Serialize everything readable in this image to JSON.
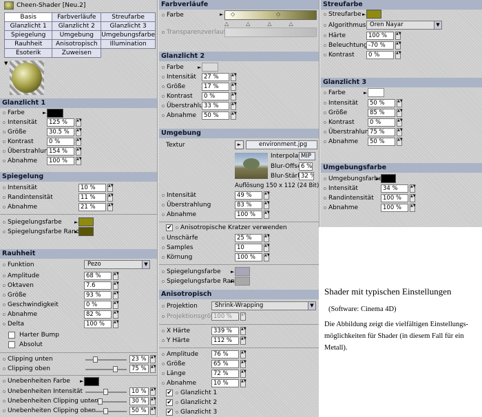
{
  "window": {
    "title": "Cheen-Shader [Neu.2]"
  },
  "tabs": [
    "Basis",
    "Farbverläufe",
    "Streufarbe",
    "Glanzlicht 1",
    "Glanzlicht 2",
    "Glanzlicht 3",
    "Spiegelung",
    "Umgebung",
    "Umgebungsfarbe",
    "Rauhheit",
    "Anisotropisch",
    "Illumination",
    "Esoterik",
    "Zuweisen"
  ],
  "glanz1": {
    "title": "Glanzlicht 1",
    "farbe": "Farbe",
    "intensitat": "Intensität",
    "intensitat_val": "125 %",
    "grosse": "Größe",
    "grosse_val": "30.5 %",
    "kontrast": "Kontrast",
    "kontrast_val": "0 %",
    "uber": "Überstrahlung",
    "uber_val": "154 %",
    "abnahme": "Abnahme",
    "abnahme_val": "100 %"
  },
  "spiegel": {
    "title": "Spiegelung",
    "intensitat": "Intensität",
    "intensitat_val": "10 %",
    "rand": "Randintensität",
    "rand_val": "11 %",
    "abnahme": "Abnahme",
    "abnahme_val": "21 %",
    "farbe": "Spiegelungsfarbe",
    "farbe_rand": "Spiegelungsfarbe Rand"
  },
  "rauh": {
    "title": "Rauhheit",
    "funktion": "Funktion",
    "funktion_val": "Pezo",
    "amplitude": "Amplitude",
    "amplitude_val": "68 %",
    "oktaven": "Oktaven",
    "oktaven_val": "7.6",
    "grosse": "Größe",
    "grosse_val": "93 %",
    "geschw": "Geschwindigkeit",
    "geschw_val": "0 %",
    "abnahme": "Abnahme",
    "abnahme_val": "82 %",
    "delta": "Delta",
    "delta_val": "100 %",
    "harter": "Harter Bump",
    "absolut": "Absolut",
    "clip_u": "Clipping unten",
    "clip_u_val": "23 %",
    "clip_o": "Clipping oben",
    "clip_o_val": "75 %",
    "un_farbe": "Unebenheiten Farbe",
    "un_int": "Unebenheiten Intensität",
    "un_int_val": "10 %",
    "un_cu": "Unebenheiten Clipping unten",
    "un_cu_val": "30 %",
    "un_co": "Unebenheiten Clipping oben",
    "un_co_val": "50 %"
  },
  "farbverl": {
    "title": "Farbverläufe",
    "farbe": "Farbe",
    "transp": "Transparenzverlauf"
  },
  "glanz2": {
    "title": "Glanzlicht 2",
    "farbe": "Farbe",
    "intensitat": "Intensität",
    "intensitat_val": "27 %",
    "grosse": "Größe",
    "grosse_val": "17 %",
    "kontrast": "Kontrast",
    "kontrast_val": "0 %",
    "uber": "Überstrahlung",
    "uber_val": "33 %",
    "abnahme": "Abnahme",
    "abnahme_val": "50 %"
  },
  "umgebung": {
    "title": "Umgebung",
    "textur": "Textur",
    "file": "environment.jpg",
    "interp": "Interpolation",
    "interp_val": "MIP",
    "blur_off": "Blur-Offset",
    "blur_off_val": "6 %",
    "blur_st": "Blur-Stärke",
    "blur_st_val": "32 %",
    "aufl": "Auflösung 150 x 112  (24 Bit)",
    "intensitat": "Intensität",
    "intensitat_val": "49 %",
    "uber": "Überstrahlung",
    "uber_val": "83 %",
    "abnahme": "Abnahme",
    "abnahme_val": "100 %",
    "aniso_chk": "Anisotropische Kratzer verwenden",
    "unsch": "Unschärfe",
    "unsch_val": "25 %",
    "samples": "Samples",
    "samples_val": "10",
    "kornung": "Körnung",
    "kornung_val": "100 %",
    "sp_farbe": "Spiegelungsfarbe",
    "sp_rand": "Spiegelungsfarbe Rand"
  },
  "aniso": {
    "title": "Anisotropisch",
    "proj": "Projektion",
    "proj_val": "Shrink-Wrapping",
    "projg": "Projektionsgröße",
    "projg_val": "100 %",
    "xh": "X Härte",
    "xh_val": "339 %",
    "yh": "Y Härte",
    "yh_val": "112 %",
    "amp": "Amplitude",
    "amp_val": "76 %",
    "gr": "Größe",
    "gr_val": "65 %",
    "la": "Länge",
    "la_val": "72 %",
    "ab": "Abnahme",
    "ab_val": "10 %",
    "g1": "Glanzlicht 1",
    "g2": "Glanzlicht 2",
    "g3": "Glanzlicht 3"
  },
  "streu": {
    "title": "Streufarbe",
    "farbe": "Streufarbe",
    "algo": "Algorithmus",
    "algo_val": "Oren Nayar",
    "harte": "Härte",
    "harte_val": "100 %",
    "bel": "Beleuchtung",
    "bel_val": "-70 %",
    "kontrast": "Kontrast",
    "kontrast_val": "0 %"
  },
  "glanz3": {
    "title": "Glanzlicht 3",
    "farbe": "Farbe",
    "intensitat": "Intensität",
    "intensitat_val": "50 %",
    "grosse": "Größe",
    "grosse_val": "85 %",
    "kontrast": "Kontrast",
    "kontrast_val": "0 %",
    "uber": "Überstrahlung",
    "uber_val": "75 %",
    "abnahme": "Abnahme",
    "abnahme_val": "50 %"
  },
  "umgfarbe": {
    "title": "Umgebungsfarbe",
    "farbe": "Umgebungsfarbe",
    "intensitat": "Intensität",
    "intensitat_val": "34 %",
    "rand": "Randintensität",
    "rand_val": "100 %",
    "abnahme": "Abnahme",
    "abnahme_val": "100 %"
  },
  "caption": {
    "title": "Shader mit typischen Einstellungen",
    "software": "(Software: Cinema 4D)",
    "line1": "Die Abbildung zeigt die vielfältigen Einstellungs-",
    "line2": "möglichkeiten für Shader (in diesem Fall für ein",
    "line3": "Metall)."
  },
  "colors": {
    "section_bg": "#aab4c6",
    "olive": "#8f8a12",
    "dark_olive": "#5b5606",
    "black": "#000000"
  }
}
